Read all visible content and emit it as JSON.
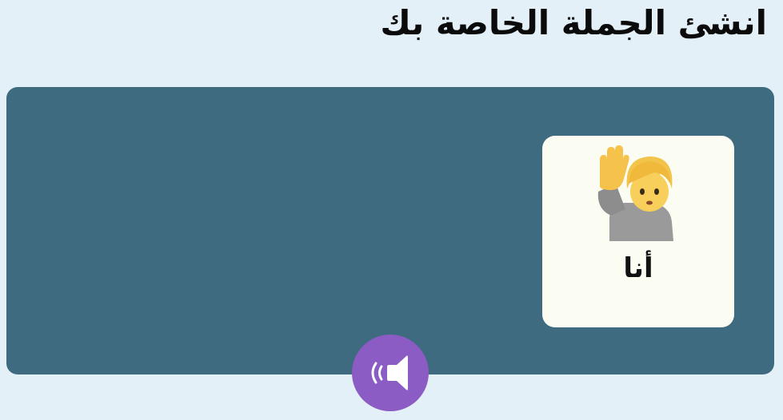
{
  "header": {
    "title": "انشئ الجملة الخاصة بك"
  },
  "sentence_area": {
    "cards": [
      {
        "label": "أنا",
        "icon": "person-raising-hand-icon"
      }
    ]
  },
  "controls": {
    "audio_icon": "speaker-icon",
    "audio_color": "#8a5cc4"
  },
  "colors": {
    "background": "#e3f0f8",
    "sentence_area": "#3e6b80",
    "card": "#fbfdf3",
    "accent": "#8a5cc4"
  }
}
